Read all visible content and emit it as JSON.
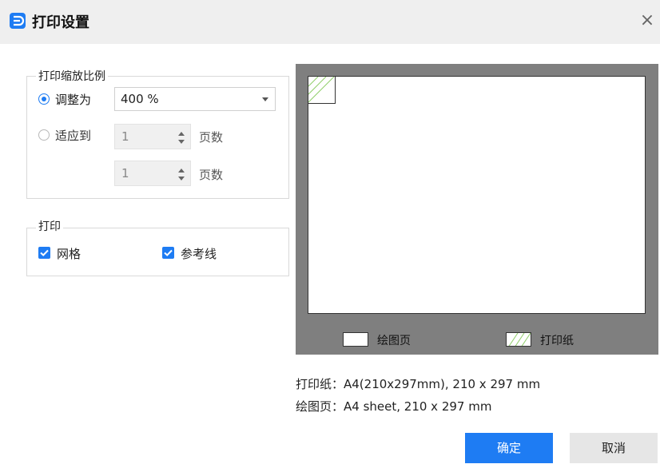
{
  "dialog": {
    "title": "打印设置",
    "close_glyph": "×"
  },
  "scale_group": {
    "legend": "打印缩放比例",
    "adjust_label": "调整为",
    "adjust_value": "400 %",
    "fit_label": "适应到",
    "fit_width_value": "1",
    "fit_height_value": "1",
    "pages_unit": "页数"
  },
  "print_group": {
    "legend": "打印",
    "grid_label": "网格",
    "grid_checked": true,
    "guides_label": "参考线",
    "guides_checked": true
  },
  "preview": {
    "drawing_page_legend": "绘图页",
    "print_paper_legend": "打印纸",
    "background_color": "#7f7f7f"
  },
  "info": {
    "print_paper": "打印纸：A4(210x297mm), 210 x 297 mm",
    "drawing_page": "绘图页：A4 sheet, 210 x 297 mm"
  },
  "buttons": {
    "ok": "确定",
    "cancel": "取消"
  },
  "colors": {
    "accent": "#1e7cf3",
    "hatch": "#8fce6a"
  },
  "icons": {
    "app": "app-logo-icon",
    "close": "close-icon",
    "dropdown": "chevron-down-icon"
  }
}
